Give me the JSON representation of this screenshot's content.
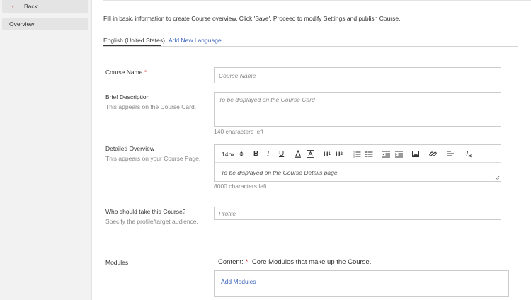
{
  "sidebar": {
    "back_label": "Back",
    "overview_label": "Overview"
  },
  "intro_text": "Fill in basic information to create Course overview. Click 'Save'. Proceed to modify Settings and publish Course.",
  "tabs": {
    "active": "English (United States)",
    "add_language": "Add New Language"
  },
  "course_name": {
    "label": "Course Name",
    "required_mark": "*",
    "placeholder": "Course Name"
  },
  "brief_description": {
    "label": "Brief Description",
    "help": "This appears on the Course Card.",
    "placeholder": "To be displayed on the Course Card",
    "counter": "140 characters left"
  },
  "detailed_overview": {
    "label": "Detailed Overview",
    "help": "This appears on your Course Page.",
    "placeholder": "To be displayed on the Course Details page",
    "counter": "8000 characters left",
    "font_size": "14px",
    "toolbar_icons": [
      "font-size-select",
      "bold",
      "italic",
      "underline",
      "font-color",
      "highlight",
      "heading-1",
      "heading-2",
      "ordered-list",
      "bullet-list",
      "outdent",
      "indent",
      "image",
      "link",
      "align",
      "clear-format"
    ]
  },
  "audience": {
    "label": "Who should take this Course?",
    "help": "Specify the profile/target audience.",
    "placeholder": "Profile"
  },
  "modules": {
    "label": "Modules",
    "content_label": "Content:",
    "required_mark": "*",
    "content_help": "Core Modules that make up the Course.",
    "add_label": "Add Modules"
  },
  "colors": {
    "required": "#d32f2f",
    "link": "#3a63b8"
  }
}
